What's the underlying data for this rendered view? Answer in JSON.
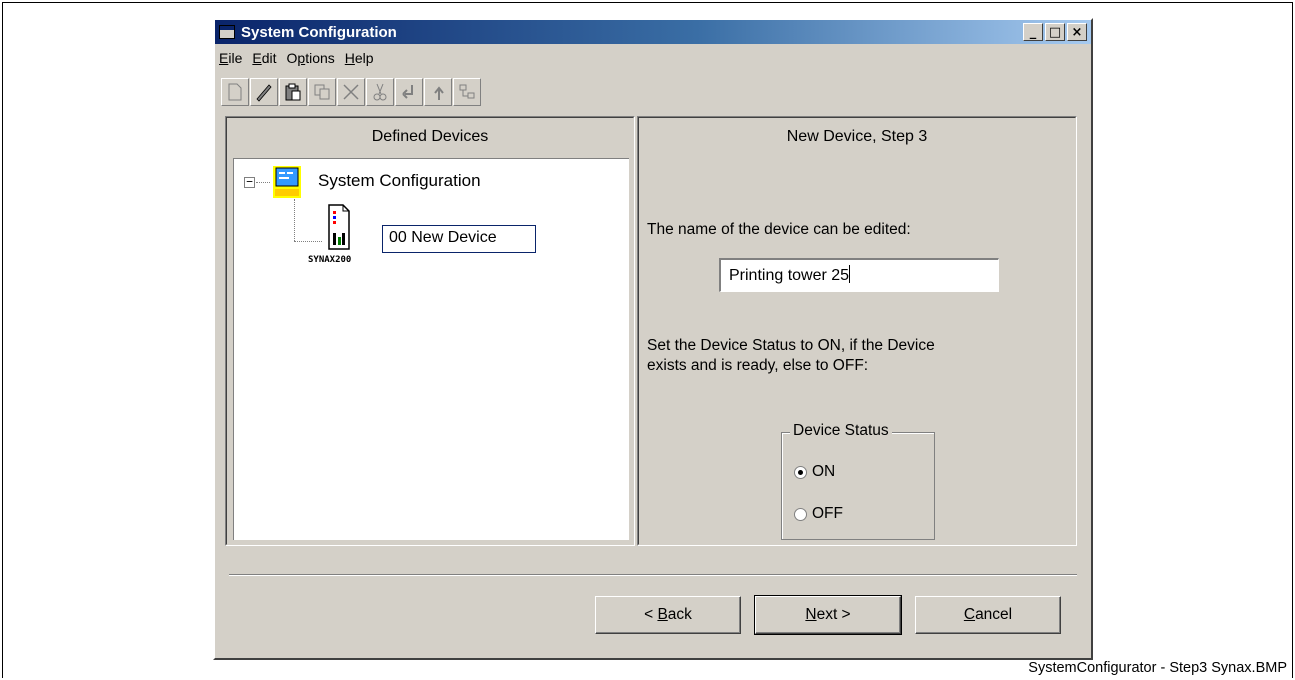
{
  "window": {
    "title": "System Configuration",
    "caption_buttons": [
      "_",
      "□",
      "×"
    ]
  },
  "menu": [
    {
      "key": "E",
      "rest": "ile"
    },
    {
      "key": "E",
      "rest": "dit"
    },
    {
      "pre": "O",
      "key": "p",
      "rest": "tions"
    },
    {
      "key": "H",
      "rest": "elp"
    }
  ],
  "toolbar": {
    "buttons": [
      "new-icon",
      "edit-icon",
      "paste-icon",
      "copy-icon",
      "delete-icon",
      "cut-icon",
      "move-down-icon",
      "move-up-icon",
      "properties-icon"
    ]
  },
  "left_panel": {
    "header": "Defined Devices",
    "tree": {
      "expander": "−",
      "root_label": "System Configuration",
      "device_caption": "SYNAX200",
      "device_label": "00  New Device"
    }
  },
  "right_panel": {
    "header": "New Device, Step 3",
    "name_prompt": "The name of the device can be edited:",
    "name_value": "Printing tower 25",
    "status_line1": "Set the Device Status to ON, if the Device",
    "status_line2": "exists and is ready, else to OFF:",
    "group_label": "Device Status",
    "option_on": "ON",
    "option_off": "OFF",
    "selected": "ON"
  },
  "buttons": {
    "back": {
      "pre": "< ",
      "key": "B",
      "rest": "ack"
    },
    "next": {
      "key": "N",
      "rest": "ext >"
    },
    "cancel": {
      "key": "C",
      "rest": "ancel"
    }
  },
  "footer_caption": "SystemConfigurator - Step3 Synax.BMP"
}
